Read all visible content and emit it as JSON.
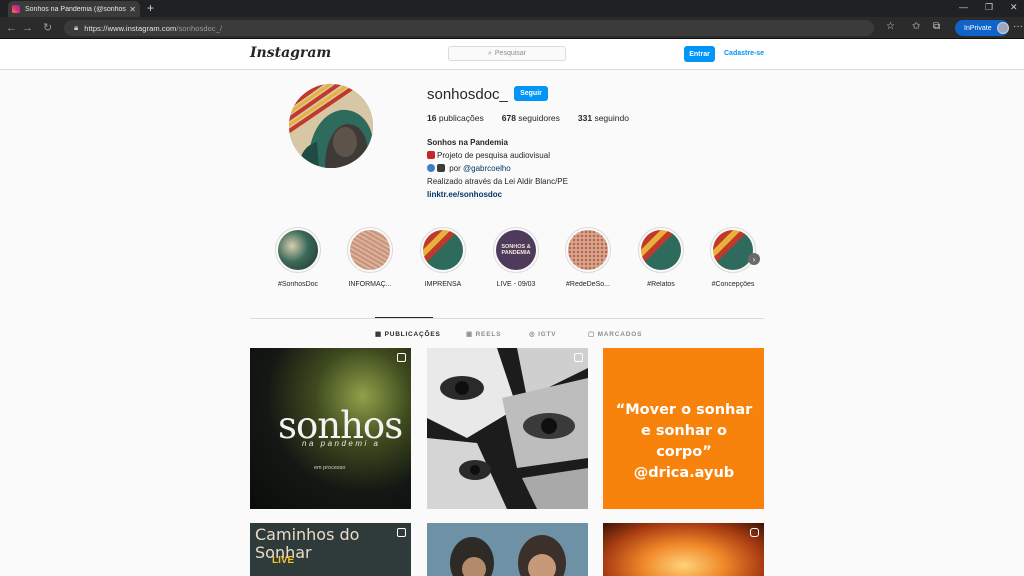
{
  "browser": {
    "tab_title": "Sonhos na Pandemia (@sonhosdoc_",
    "tab_close": "✕",
    "new_tab": "+",
    "url_host": "https://www.instagram.com",
    "url_path": "/sonhosdoc_/",
    "inprivate_label": "InPrivate",
    "icons": [
      "back-icon",
      "forward-icon",
      "refresh-icon",
      "lock-icon",
      "extension-icon",
      "favorites-icon",
      "collections-icon",
      "profile-icon",
      "more-icon"
    ]
  },
  "header": {
    "logo": "Instagram",
    "search_placeholder": "Pesquisar",
    "login_label": "Entrar",
    "signup_label": "Cadastre-se"
  },
  "profile": {
    "username": "sonhosdoc_",
    "follow_label": "Seguir",
    "posts_count": "16",
    "posts_label": "publicações",
    "followers_count": "678",
    "followers_label": "seguidores",
    "following_count": "331",
    "following_label": "seguindo",
    "display_name": "Sonhos na Pandemia",
    "bio_line1": "Projeto de pesquisa audiovisual",
    "bio_line2_prefix": "por",
    "bio_mention": "@gabrcoelho",
    "bio_line3": "Realizado através da Lei Aldir Blanc/PE",
    "bio_link": "linktr.ee/sonhosdoc"
  },
  "highlights": [
    {
      "label": "#SonhosDoc"
    },
    {
      "label": "INFORMAÇ..."
    },
    {
      "label": "IMPRENSA"
    },
    {
      "label": "LIVE - 09/03"
    },
    {
      "label": "#RedeDeSo..."
    },
    {
      "label": "#Relatos"
    },
    {
      "label": "#Concepções"
    }
  ],
  "highlight_live_text": "SONHOS & PANDEMIA",
  "tabs": [
    {
      "label": "PUBLICAÇÕES",
      "active": true
    },
    {
      "label": "REELS",
      "active": false
    },
    {
      "label": "IGTV",
      "active": false
    },
    {
      "label": "MARCADOS",
      "active": false
    }
  ],
  "posts": {
    "p1_title": "sonhos",
    "p1_subtitle": "na pandemi a",
    "p1_caption": "em processo",
    "p3_quote": "“Mover o sonhar e sonhar o corpo” @drica.ayub",
    "p4_title": "Caminhos do Sonhar",
    "p4_live": "LIVE"
  },
  "colors": {
    "accent": "#0095f6",
    "link": "#00376b",
    "orange_post": "#f7830c",
    "inprivate": "#0f63c9"
  }
}
